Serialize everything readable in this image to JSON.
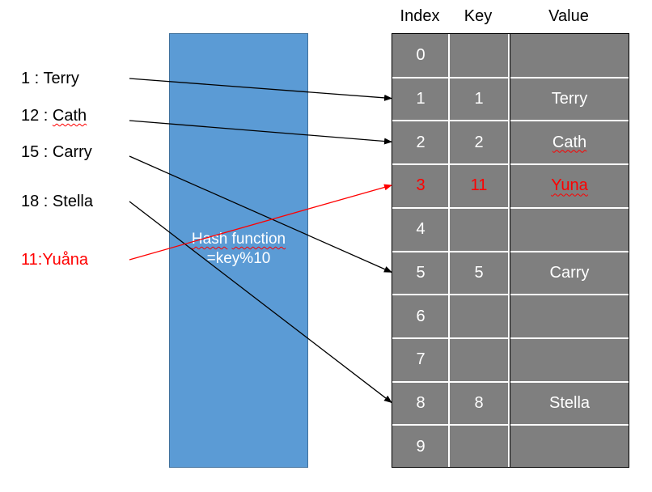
{
  "inputs": [
    {
      "key_label": "1 : ",
      "name": "Terry",
      "spell": false,
      "highlight": false,
      "target_row": 1
    },
    {
      "key_label": "12 : ",
      "name": "Cath",
      "spell": true,
      "highlight": false,
      "target_row": 2
    },
    {
      "key_label": "15 : ",
      "name": "Carry",
      "spell": false,
      "highlight": false,
      "target_row": 5
    },
    {
      "key_label": "18 : ",
      "name": "Stella",
      "spell": false,
      "highlight": false,
      "target_row": 8
    },
    {
      "key_label": "11:",
      "name": "Yuåna",
      "spell": false,
      "highlight": true,
      "target_row": 3
    }
  ],
  "hash_function": {
    "line1_a": "Hash",
    "line1_b": "function",
    "line2": "=key%10"
  },
  "table": {
    "headers": {
      "index": "Index",
      "key": "Key",
      "value": "Value"
    },
    "rows": [
      {
        "index": "0",
        "key": "",
        "value": "",
        "highlight": false,
        "spell": false
      },
      {
        "index": "1",
        "key": "1",
        "value": "Terry",
        "highlight": false,
        "spell": false
      },
      {
        "index": "2",
        "key": "2",
        "value": "Cath",
        "highlight": false,
        "spell": true
      },
      {
        "index": "3",
        "key": "11",
        "value": "Yuna",
        "highlight": true,
        "spell": true
      },
      {
        "index": "4",
        "key": "",
        "value": "",
        "highlight": false,
        "spell": false
      },
      {
        "index": "5",
        "key": "5",
        "value": "Carry",
        "highlight": false,
        "spell": false
      },
      {
        "index": "6",
        "key": "",
        "value": "",
        "highlight": false,
        "spell": false
      },
      {
        "index": "7",
        "key": "",
        "value": "",
        "highlight": false,
        "spell": false
      },
      {
        "index": "8",
        "key": "8",
        "value": "Stella",
        "highlight": false,
        "spell": false
      },
      {
        "index": "9",
        "key": "",
        "value": "",
        "highlight": false,
        "spell": false
      }
    ]
  },
  "colors": {
    "hash_box": "#5b9bd5",
    "table_cell": "#7f7f7f",
    "highlight": "#ff0000",
    "arrow": "#000000"
  }
}
